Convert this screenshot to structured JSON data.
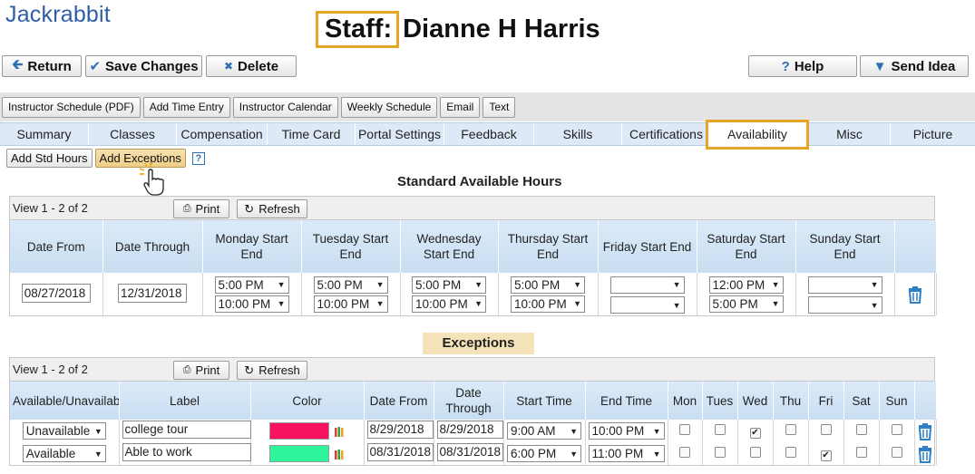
{
  "app": {
    "logo": "Jackrabbit"
  },
  "header": {
    "title_prefix": "Staff:",
    "staff_name": "Dianne H Harris"
  },
  "toolbar": {
    "return_label": "Return",
    "save_label": "Save Changes",
    "delete_label": "Delete",
    "help_label": "Help",
    "send_idea_label": "Send Idea"
  },
  "subtoolbar": [
    "Instructor Schedule (PDF)",
    "Add Time Entry",
    "Instructor Calendar",
    "Weekly Schedule",
    "Email",
    "Text"
  ],
  "tabs": [
    "Summary",
    "Classes",
    "Compensation",
    "Time Card",
    "Portal Settings",
    "Feedback",
    "Skills",
    "Certifications",
    "Availability",
    "Misc",
    "Picture"
  ],
  "active_tab": "Availability",
  "actions": {
    "add_std_hours": "Add Std Hours",
    "add_exceptions": "Add Exceptions",
    "help_glyph": "?"
  },
  "standard": {
    "title": "Standard Available Hours",
    "view_text": "View 1 - 2 of 2",
    "print_label": "Print",
    "refresh_label": "Refresh",
    "headers": [
      "Date From",
      "Date Through",
      "Monday Start End",
      "Tuesday Start End",
      "Wednesday Start End",
      "Thursday Start End",
      "Friday Start End",
      "Saturday Start End",
      "Sunday Start End"
    ],
    "row": {
      "date_from": "08/27/2018",
      "date_through": "12/31/2018",
      "mon_start": "5:00 PM",
      "mon_end": "10:00 PM",
      "tue_start": "5:00 PM",
      "tue_end": "10:00 PM",
      "wed_start": "5:00 PM",
      "wed_end": "10:00 PM",
      "thu_start": "5:00 PM",
      "thu_end": "10:00 PM",
      "fri_start": "",
      "fri_end": "",
      "sat_start": "12:00 PM",
      "sat_end": "5:00 PM",
      "sun_start": "",
      "sun_end": ""
    }
  },
  "exceptions": {
    "title": "Exceptions",
    "view_text": "View 1 - 2 of 2",
    "print_label": "Print",
    "refresh_label": "Refresh",
    "headers": [
      "Available/Unavailable",
      "Label",
      "Color",
      "Date From",
      "Date Through",
      "Start Time",
      "End Time",
      "Mon",
      "Tues",
      "Wed",
      "Thu",
      "Fri",
      "Sat",
      "Sun"
    ],
    "rows": [
      {
        "status": "Unavailable",
        "label": "college tour",
        "color": "#f7135f",
        "date_from": "8/29/2018",
        "date_through": "8/29/2018",
        "start": "9:00 AM",
        "end": "10:00 PM",
        "days": [
          false,
          false,
          true,
          false,
          false,
          false,
          false
        ]
      },
      {
        "status": "Available",
        "label": "Able to work",
        "color": "#2ef59a",
        "date_from": "08/31/2018",
        "date_through": "08/31/2018",
        "start": "6:00 PM",
        "end": "11:00 PM",
        "days": [
          false,
          false,
          false,
          false,
          true,
          false,
          false
        ]
      }
    ]
  },
  "colors": {
    "accent_highlight": "#e6a526",
    "tab_bg": "#dde9f7",
    "icon_blue": "#2f7fc7"
  }
}
